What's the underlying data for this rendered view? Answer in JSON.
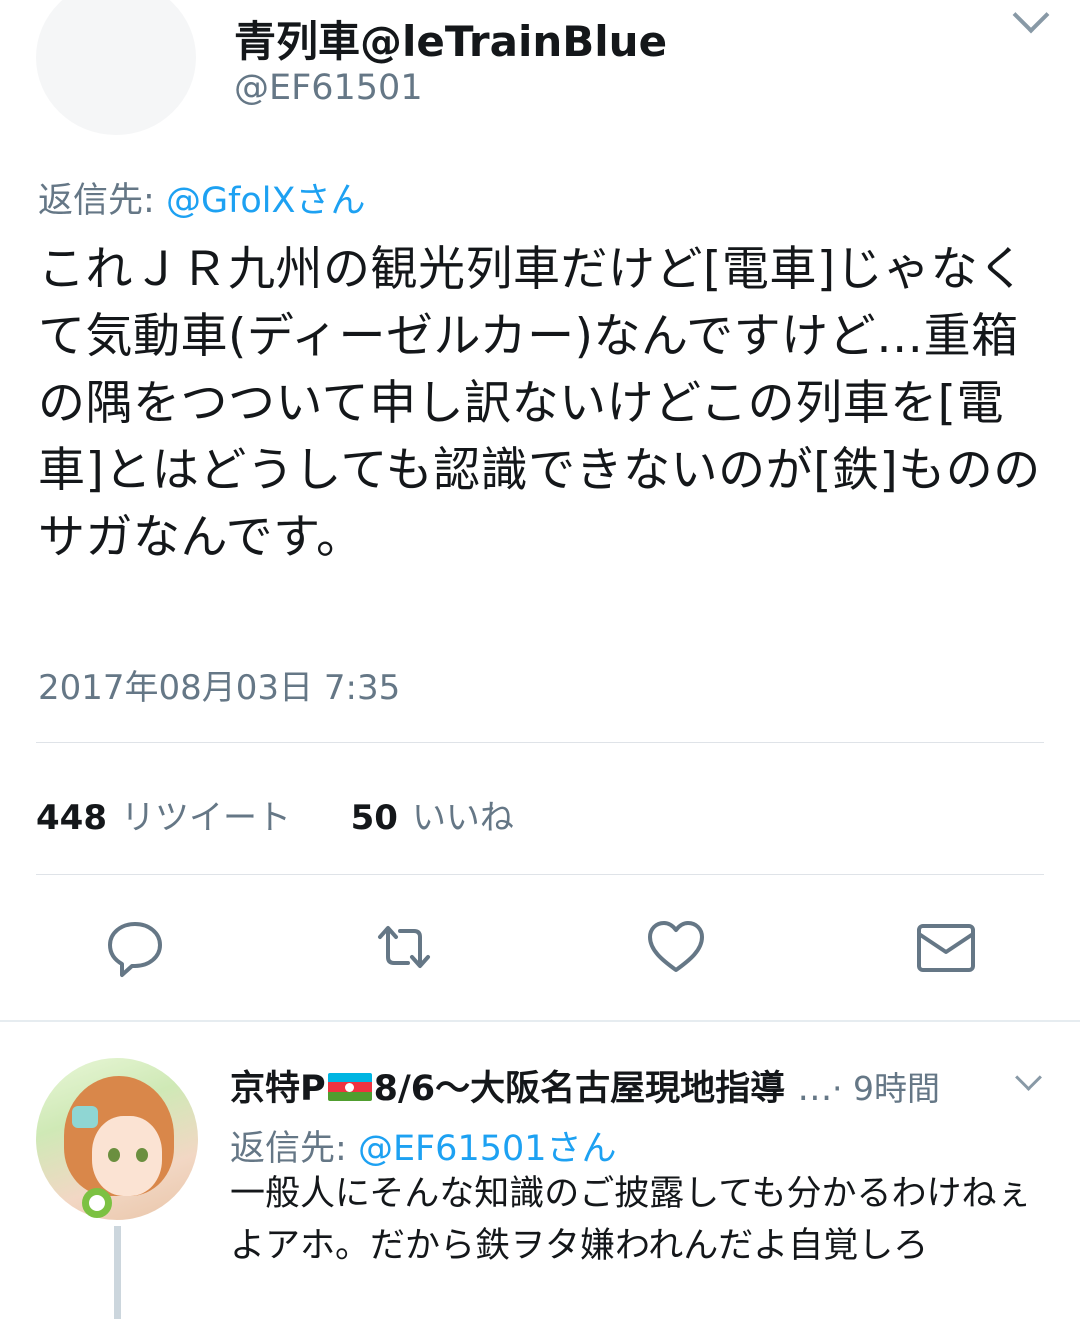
{
  "tweet": {
    "display_name": "青列車@leTrainBlue",
    "handle": "@EF61501",
    "reply_to_label": "返信先:",
    "reply_to_mention": "@GfolXさん",
    "body": "これＪＲ九州の観光列車だけど[電車]じゃなくて気動車(ディーゼルカー)なんですけど…重箱の隅をつついて申し訳ないけどこの列車を[電車]とはどうしても認識できないのが[鉄]もののサガなんです。",
    "timestamp": "2017年08月03日 7:35",
    "retweets": {
      "count": "448",
      "label": "リツイート"
    },
    "likes": {
      "count": "50",
      "label": "いいね"
    },
    "actions": [
      "reply-icon",
      "retweet-icon",
      "like-icon",
      "direct-message-icon"
    ]
  },
  "reply": {
    "display_name_prefix": "京特P",
    "flag": "azerbaijan-flag",
    "display_name_suffix": "8/6〜大阪名古屋現地指導",
    "ellipsis": "…",
    "time": "· 9時間",
    "reply_to_label": "返信先:",
    "reply_to_mention": "@EF61501さん",
    "body": "一般人にそんな知識のご披露しても分かるわけねぇよアホ。だから鉄ヲタ嫌われんだよ自覚しろ"
  },
  "colors": {
    "link": "#1da1f2",
    "secondary_text": "#657786",
    "primary_text": "#14171a",
    "icon": "#657786",
    "online": "#7cc142"
  }
}
